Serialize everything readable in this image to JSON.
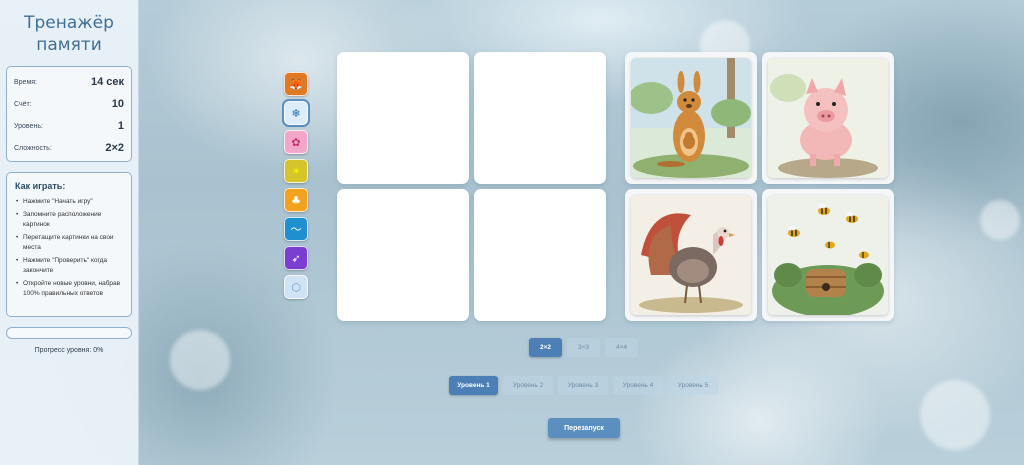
{
  "app": {
    "title": "Тренажёр памяти"
  },
  "stats": [
    {
      "label": "Время:",
      "value": "14 сек"
    },
    {
      "label": "Счёт:",
      "value": "10"
    },
    {
      "label": "Уровень:",
      "value": "1"
    },
    {
      "label": "Сложность:",
      "value": "2×2"
    }
  ],
  "howto": {
    "title": "Как играть:",
    "items": [
      "Нажмите \"Начать игру\"",
      "Запомните расположение картинок",
      "Перетащите картинки на свои места",
      "Нажмите \"Проверить\" когда закончите",
      "Откройте новые уровни, набрав 100% правильных ответов"
    ]
  },
  "progress": {
    "text": "Прогресс уровня: 0%",
    "fraction": 0
  },
  "themes": [
    {
      "icon": "fox-icon",
      "glyph": "🦊",
      "color": "#e07a22",
      "active": false
    },
    {
      "icon": "snowflake-icon",
      "glyph": "❄",
      "color": "#dcecf8",
      "active": true
    },
    {
      "icon": "flower-icon",
      "glyph": "✿",
      "color": "#f2a6c8",
      "active": false
    },
    {
      "icon": "sun-icon",
      "glyph": "☀",
      "color": "#d6c52a",
      "active": false
    },
    {
      "icon": "mushroom-icon",
      "glyph": "♣",
      "color": "#f2a21c",
      "active": false
    },
    {
      "icon": "wave-icon",
      "glyph": "〜",
      "color": "#1f8fd0",
      "active": false
    },
    {
      "icon": "rocket-icon",
      "glyph": "➶",
      "color": "#7a3fd0",
      "active": false
    },
    {
      "icon": "gem-icon",
      "glyph": "⬡",
      "color": "#cfe3f5",
      "active": false
    }
  ],
  "cards": [
    {
      "state": "empty"
    },
    {
      "state": "empty"
    },
    {
      "state": "image",
      "subject": "kangaroo"
    },
    {
      "state": "image",
      "subject": "pig"
    },
    {
      "state": "empty"
    },
    {
      "state": "empty"
    },
    {
      "state": "image",
      "subject": "turkey"
    },
    {
      "state": "image",
      "subject": "bees"
    }
  ],
  "sizes": [
    {
      "label": "2×2",
      "active": true
    },
    {
      "label": "3×3",
      "active": false
    },
    {
      "label": "4×4",
      "active": false
    }
  ],
  "levels": [
    {
      "label": "Уровень 1",
      "active": true
    },
    {
      "label": "Уровень 2",
      "active": false
    },
    {
      "label": "Уровень 3",
      "active": false
    },
    {
      "label": "Уровень 4",
      "active": false
    },
    {
      "label": "Уровень 5",
      "active": false
    }
  ],
  "restart_label": "Перезапуск"
}
